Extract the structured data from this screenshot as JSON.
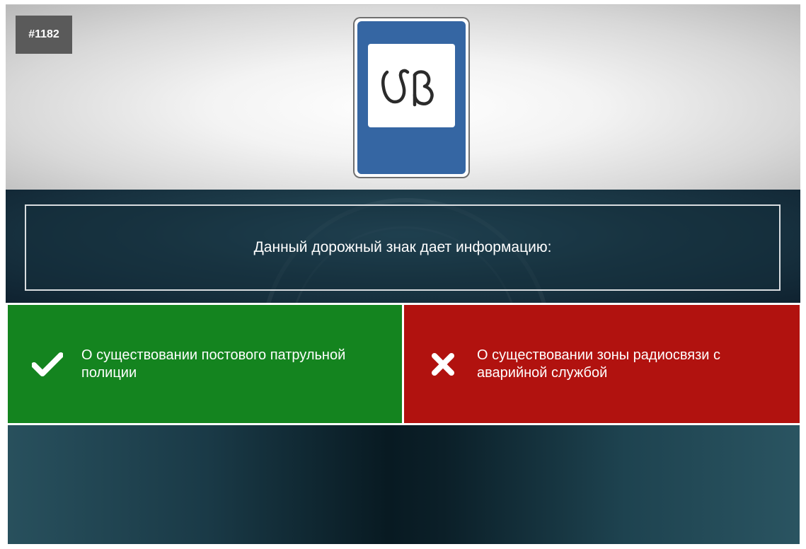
{
  "ticket": {
    "number": "#1182"
  },
  "sign": {
    "glyph": "სპ",
    "colors": {
      "blue": "#3566a3",
      "panel": "#ffffff"
    }
  },
  "question": {
    "text": "Данный дорожный знак дает информацию:"
  },
  "answers": [
    {
      "label": "О существовании постового патрульной полиции",
      "status": "correct",
      "icon": "checkmark-icon",
      "color": "#14841f"
    },
    {
      "label": "О существовании зоны радиосвязи с аварийной службой",
      "status": "wrong",
      "icon": "cross-icon",
      "color": "#b1120f"
    }
  ]
}
